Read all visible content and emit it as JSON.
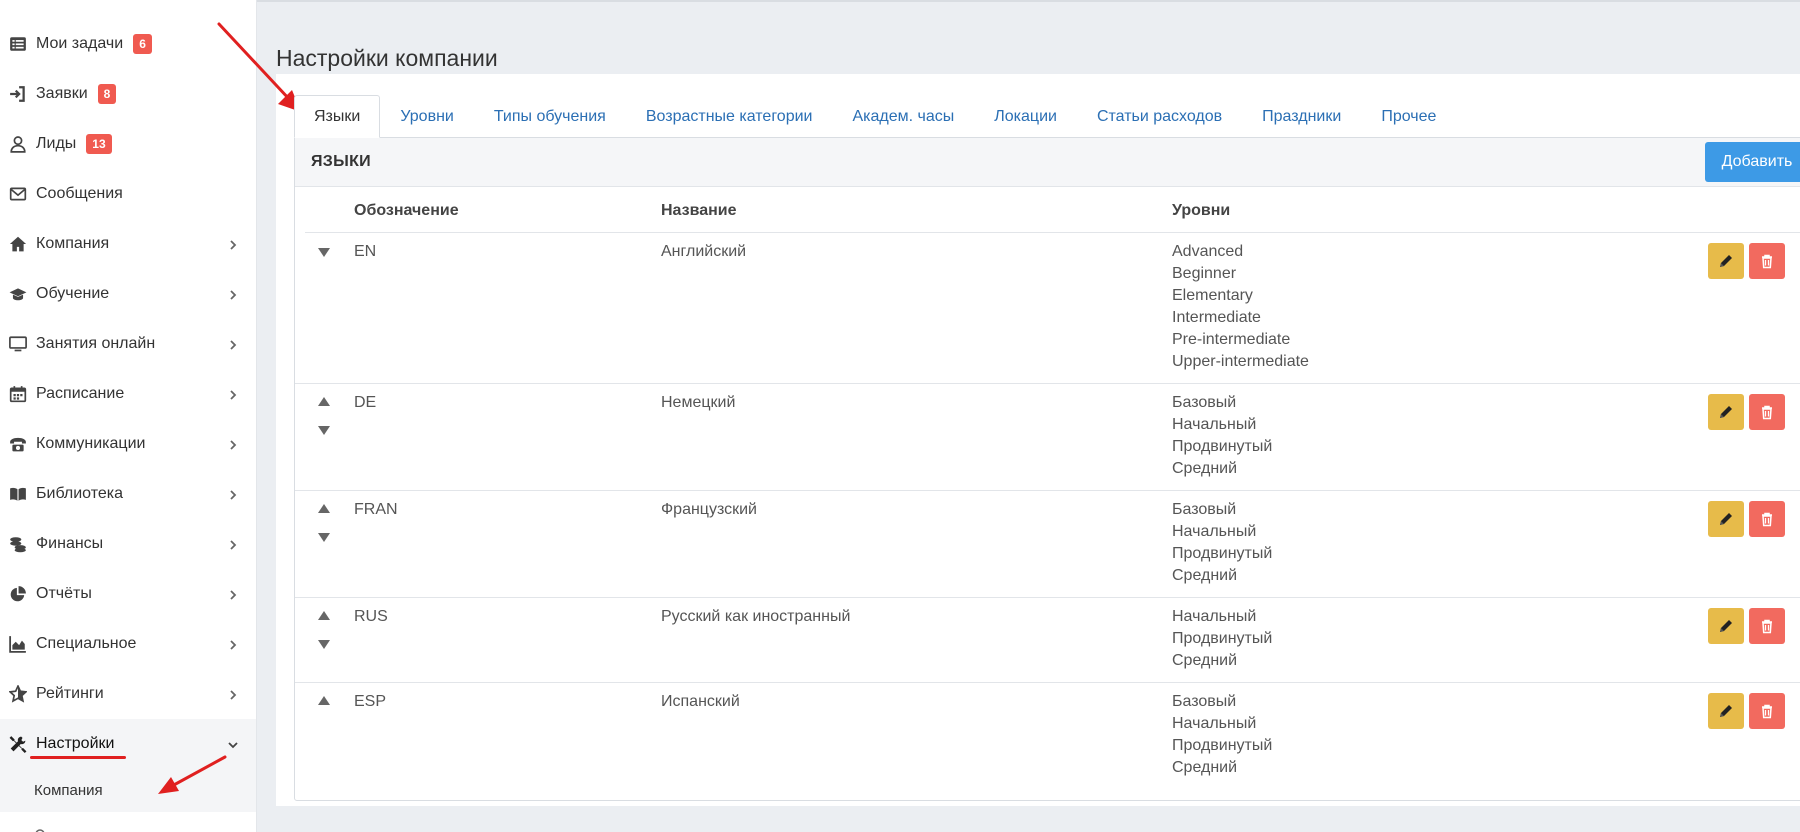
{
  "sidebar": {
    "items": [
      {
        "label": "Мои задачи",
        "icon": "list-icon",
        "badge": "6"
      },
      {
        "label": "Заявки",
        "icon": "sign-in-icon",
        "badge": "8"
      },
      {
        "label": "Лиды",
        "icon": "user-icon",
        "badge": "13"
      },
      {
        "label": "Сообщения",
        "icon": "envelope-icon"
      },
      {
        "label": "Компания",
        "icon": "home-icon"
      },
      {
        "label": "Обучение",
        "icon": "graduation-cap-icon"
      },
      {
        "label": "Занятия онлайн",
        "icon": "monitor-icon"
      },
      {
        "label": "Расписание",
        "icon": "calendar-icon"
      },
      {
        "label": "Коммуникации",
        "icon": "phone-icon"
      },
      {
        "label": "Библиотека",
        "icon": "book-icon"
      },
      {
        "label": "Финансы",
        "icon": "coins-icon"
      },
      {
        "label": "Отчёты",
        "icon": "pie-chart-icon"
      },
      {
        "label": "Специальное",
        "icon": "area-chart-icon"
      },
      {
        "label": "Рейтинги",
        "icon": "star-icon"
      },
      {
        "label": "Настройки",
        "icon": "tools-icon"
      }
    ],
    "submenu": {
      "label": "Компания"
    }
  },
  "page": {
    "title": "Настройки компании"
  },
  "tabs": [
    "Языки",
    "Уровни",
    "Типы обучения",
    "Возрастные категории",
    "Академ. часы",
    "Локации",
    "Статьи расходов",
    "Праздники",
    "Прочее"
  ],
  "card": {
    "title": "ЯЗЫКИ",
    "add_label": "Добавить"
  },
  "table": {
    "headers": [
      "Обозначение",
      "Название",
      "Уровни"
    ],
    "rows": [
      {
        "code": "EN",
        "name": "Английский",
        "levels": [
          "Advanced",
          "Beginner",
          "Elementary",
          "Intermediate",
          "Pre-intermediate",
          "Upper-intermediate"
        ]
      },
      {
        "code": "DE",
        "name": "Немецкий",
        "levels": [
          "Базовый",
          "Начальный",
          "Продвинутый",
          "Средний"
        ]
      },
      {
        "code": "FRAN",
        "name": "Французский",
        "levels": [
          "Базовый",
          "Начальный",
          "Продвинутый",
          "Средний"
        ]
      },
      {
        "code": "RUS",
        "name": "Русский как иностранный",
        "levels": [
          "Начальный",
          "Продвинутый",
          "Средний"
        ]
      },
      {
        "code": "ESP",
        "name": "Испанский",
        "levels": [
          "Базовый",
          "Начальный",
          "Продвинутый",
          "Средний"
        ]
      }
    ]
  },
  "colors": {
    "accent": "#3d9ae6",
    "edit": "#e7bb4a",
    "delete": "#f26a5f",
    "badge": "#f05a50",
    "link": "#2b6fb4",
    "annotation": "#e02020"
  }
}
